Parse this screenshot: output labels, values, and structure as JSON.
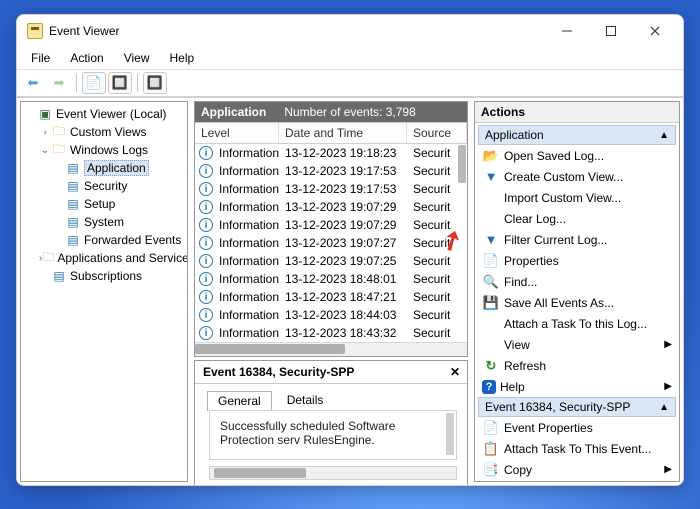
{
  "title": "Event Viewer",
  "menu": {
    "file": "File",
    "action": "Action",
    "view": "View",
    "help": "Help"
  },
  "tree": {
    "root": "Event Viewer (Local)",
    "items": [
      {
        "label": "Custom Views"
      },
      {
        "label": "Windows Logs",
        "children": [
          {
            "label": "Application",
            "selected": true
          },
          {
            "label": "Security"
          },
          {
            "label": "Setup"
          },
          {
            "label": "System"
          },
          {
            "label": "Forwarded Events"
          }
        ]
      },
      {
        "label": "Applications and Services Logs"
      },
      {
        "label": "Subscriptions"
      }
    ]
  },
  "grid": {
    "title": "Application",
    "count_label": "Number of events: 3,798",
    "cols": {
      "level": "Level",
      "date": "Date and Time",
      "source": "Source"
    },
    "rows": [
      {
        "level": "Information",
        "date": "13-12-2023 19:18:23",
        "source": "Securit"
      },
      {
        "level": "Information",
        "date": "13-12-2023 19:17:53",
        "source": "Securit"
      },
      {
        "level": "Information",
        "date": "13-12-2023 19:17:53",
        "source": "Securit"
      },
      {
        "level": "Information",
        "date": "13-12-2023 19:07:29",
        "source": "Securit"
      },
      {
        "level": "Information",
        "date": "13-12-2023 19:07:29",
        "source": "Securit"
      },
      {
        "level": "Information",
        "date": "13-12-2023 19:07:27",
        "source": "Securit"
      },
      {
        "level": "Information",
        "date": "13-12-2023 19:07:25",
        "source": "Securit"
      },
      {
        "level": "Information",
        "date": "13-12-2023 18:48:01",
        "source": "Securit"
      },
      {
        "level": "Information",
        "date": "13-12-2023 18:47:21",
        "source": "Securit"
      },
      {
        "level": "Information",
        "date": "13-12-2023 18:44:03",
        "source": "Securit"
      },
      {
        "level": "Information",
        "date": "13-12-2023 18:43:32",
        "source": "Securit"
      }
    ]
  },
  "detail": {
    "title": "Event 16384, Security-SPP",
    "tabs": {
      "general": "General",
      "details": "Details"
    },
    "message": "Successfully scheduled Software Protection serv RulesEngine."
  },
  "actions": {
    "header": "Actions",
    "group1": "Application",
    "items1": [
      {
        "icon": "📂",
        "label": "Open Saved Log..."
      },
      {
        "icon": "▼",
        "label": "Create Custom View..."
      },
      {
        "icon": "",
        "label": "Import Custom View..."
      },
      {
        "icon": "",
        "label": "Clear Log..."
      },
      {
        "icon": "▼",
        "label": "Filter Current Log..."
      },
      {
        "icon": "📄",
        "label": "Properties"
      },
      {
        "icon": "🔍",
        "label": "Find..."
      },
      {
        "icon": "💾",
        "label": "Save All Events As..."
      },
      {
        "icon": "",
        "label": "Attach a Task To this Log..."
      },
      {
        "icon": "",
        "label": "View",
        "sub": true
      },
      {
        "icon": "↻",
        "label": "Refresh"
      },
      {
        "icon": "?",
        "label": "Help",
        "sub": true
      }
    ],
    "group2": "Event 16384, Security-SPP",
    "items2": [
      {
        "icon": "📄",
        "label": "Event Properties"
      },
      {
        "icon": "📋",
        "label": "Attach Task To This Event..."
      },
      {
        "icon": "📑",
        "label": "Copy",
        "sub": true
      }
    ]
  }
}
